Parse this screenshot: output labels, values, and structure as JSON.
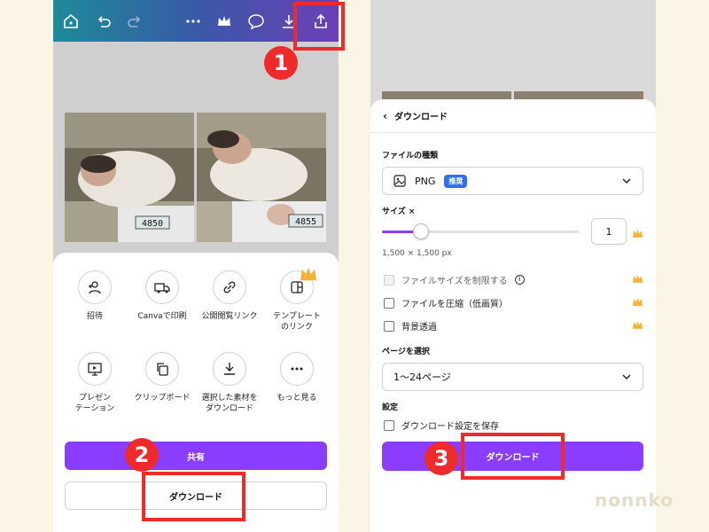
{
  "left": {
    "toolbar_icons": [
      "home-icon",
      "undo-icon",
      "redo-icon",
      "more-icon",
      "crown-icon",
      "comment-icon",
      "download-icon",
      "share-upload-icon"
    ],
    "grid": [
      {
        "label": "招待",
        "icon": "invite-icon"
      },
      {
        "label": "Canvaで印刷",
        "icon": "truck-icon"
      },
      {
        "label": "公開閲覧リンク",
        "icon": "link-icon"
      },
      {
        "label": "テンプレート\nのリンク",
        "icon": "template-icon",
        "premium": true
      },
      {
        "label": "プレゼン\nテーション",
        "icon": "presentation-icon"
      },
      {
        "label": "クリップボード",
        "icon": "copy-icon"
      },
      {
        "label": "選択した素材を\nダウンロード",
        "icon": "download-icon"
      },
      {
        "label": "もっと見る",
        "icon": "more-icon"
      }
    ],
    "share_label": "共有",
    "download_label": "ダウンロード",
    "photo_scale_1": "4850",
    "photo_scale_2": "4855"
  },
  "right": {
    "header_title": "ダウンロード",
    "file_type_label": "ファイルの種類",
    "file_type_value": "PNG",
    "file_type_badge": "推奨",
    "size_label": "サイズ ×",
    "size_value": "1",
    "size_fraction": 0.2,
    "size_dimensions": "1,500 × 1,500 px",
    "options": [
      {
        "label": "ファイルサイズを制限する",
        "disabled": true,
        "info": true
      },
      {
        "label": "ファイルを圧縮（低画質）",
        "disabled": false
      },
      {
        "label": "背景透過",
        "disabled": false
      }
    ],
    "page_select_label": "ページを選択",
    "page_select_value": "1〜24ページ",
    "settings_label": "設定",
    "save_setting_label": "ダウンロード設定を保存",
    "download_label": "ダウンロード"
  },
  "steps": [
    "1",
    "2",
    "3"
  ],
  "watermark": "nonnko",
  "colors": {
    "accent": "#8b3dff",
    "badge": "#2f6ef3",
    "annotation": "#ee2a2a",
    "crown": "#f2b43a"
  }
}
